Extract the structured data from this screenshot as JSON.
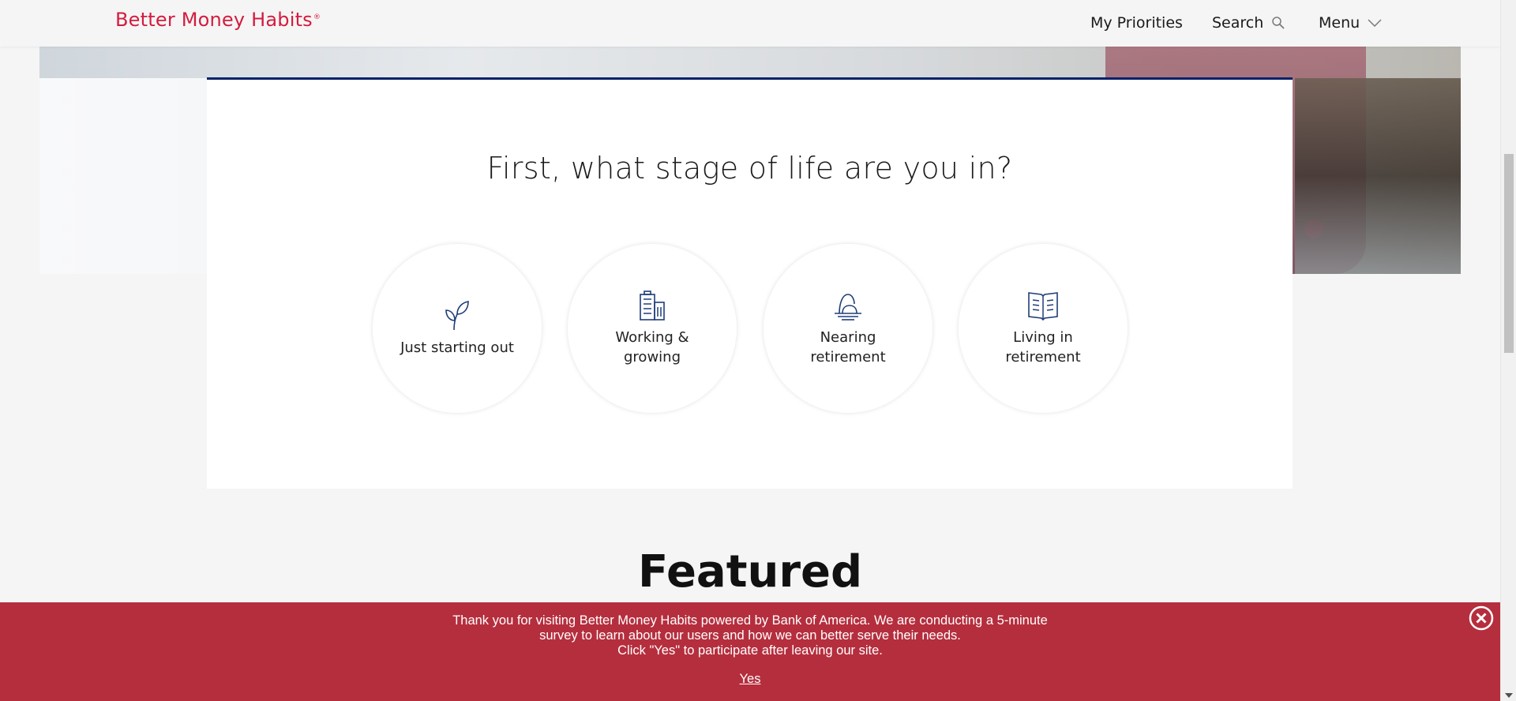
{
  "header": {
    "logo_text": "Better Money Habits",
    "logo_mark": "®",
    "nav": {
      "priorities": "My Priorities",
      "search": "Search",
      "menu": "Menu"
    }
  },
  "stage_selector": {
    "title": "First, what stage of life are you in?",
    "options": [
      {
        "label": "Just starting out",
        "icon": "sprout-icon"
      },
      {
        "label": "Working & growing",
        "icon": "office-building-icon"
      },
      {
        "label": "Nearing retirement",
        "icon": "sunset-icon"
      },
      {
        "label": "Living in retirement",
        "icon": "open-book-icon"
      }
    ]
  },
  "featured": {
    "heading": "Featured"
  },
  "survey": {
    "line1": "Thank you for visiting Better Money Habits powered by Bank of America. We are conducting a 5-minute",
    "line2": "survey to learn about our users and how we can better serve their needs.",
    "line3": "Click \"Yes\" to participate after leaving our site.",
    "yes_label": "Yes"
  },
  "colors": {
    "brand": "#d31c3f",
    "navy": "#012169",
    "survey_bg": "#b52e3d"
  }
}
